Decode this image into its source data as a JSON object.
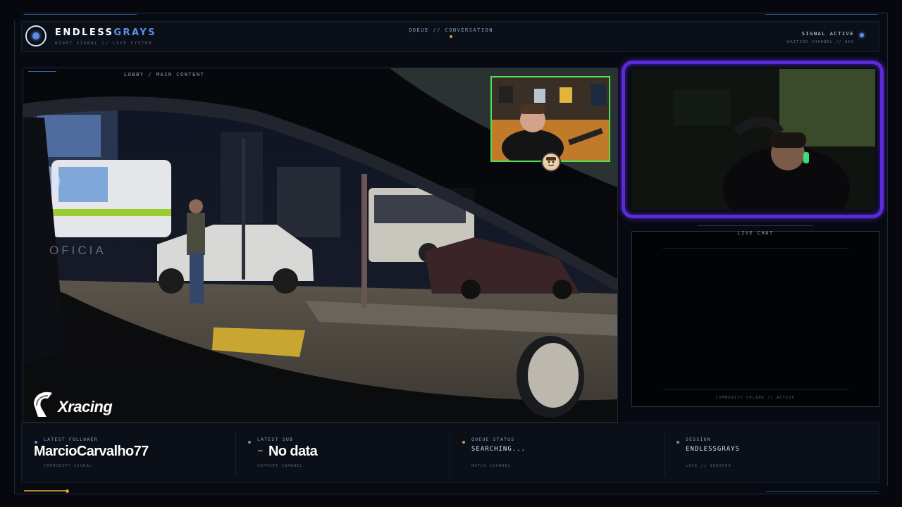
{
  "header": {
    "brand_white": "ENDLESS",
    "brand_blue": "GRAYS",
    "brand_sub": "NIGHT SIGNAL // LIVE SYSTEM",
    "center_title": "QUEUE // CONVERSATION",
    "signal_status": "SIGNAL ACTIVE",
    "signal_sub": "WAITING CHANNEL // 002"
  },
  "main": {
    "label": "LOBBY / MAIN CONTENT",
    "watermark_text": "OFICIA",
    "logo_text": "Xracing"
  },
  "chat": {
    "title": "LIVE CHAT",
    "footer": "COMMUNITY UPLINK // ACTIVE"
  },
  "stats": [
    {
      "label": "LATEST FOLLOWER",
      "value": "MarcioCarvalho77",
      "footer": "COMMUNITY SIGNAL",
      "dot_color": "#5d8ee8"
    },
    {
      "label": "LATEST SUB",
      "value": "No data",
      "prefix": "–",
      "footer": "SUPPORT CHANNEL",
      "dot_color": "#5d8ee8"
    },
    {
      "label": "QUEUE STATUS",
      "value": "SEARCHING...",
      "footer": "MATCH CHANNEL",
      "dot_color": "#d39a36"
    },
    {
      "label": "SESSION",
      "value": "ENDLESSGRAYS",
      "footer": "LIVE // 1080P60",
      "dot_color": "#5d8ee8"
    }
  ],
  "colors": {
    "accent_blue": "#5d8ee8",
    "accent_gold": "#d39a36",
    "cam_border_green": "#4ee34e",
    "cam_border_purple": "#5b2bd6"
  },
  "icons": [
    "logo-ring-icon",
    "signal-dot-icon",
    "xracing-helmet-icon",
    "avatar-badge-icon"
  ]
}
